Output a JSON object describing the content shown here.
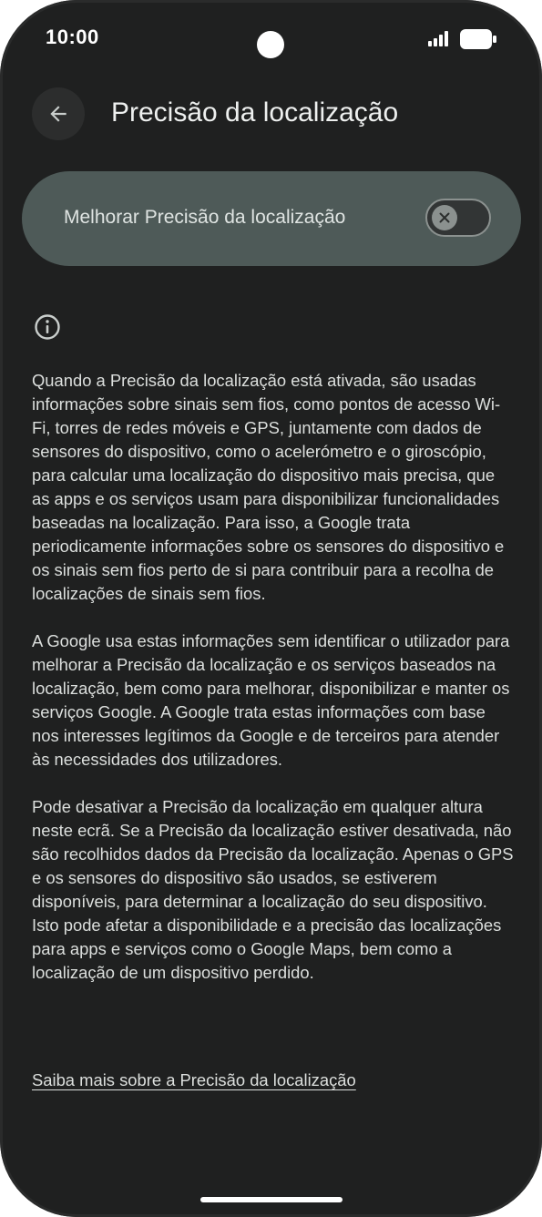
{
  "status_bar": {
    "time": "10:00",
    "icons": [
      "signal-icon",
      "battery-icon"
    ]
  },
  "top_bar": {
    "back_icon": "arrow-left-icon",
    "title": "Precisão da localização"
  },
  "main_toggle": {
    "label": "Melhorar Precisão da localização",
    "state": "off",
    "thumb_icon": "close-icon"
  },
  "info_icon": "info-icon",
  "body": {
    "paragraphs": [
      "Quando a Precisão da localização está ativada, são usadas informações sobre sinais sem fios, como pontos de acesso Wi-Fi, torres de redes móveis e GPS, juntamente com dados de sensores do dispositivo, como o acelerómetro e o giroscópio, para calcular uma localização do dispositivo mais precisa, que as apps e os serviços usam para disponibilizar funcionalidades baseadas na localização. Para isso, a Google trata periodicamente informações sobre os sensores do dispositivo e os sinais sem fios perto de si para contribuir para a recolha de localizações de sinais sem fios.",
      "A Google usa estas informações sem identificar o utilizador para melhorar a Precisão da localização e os serviços baseados na localização, bem como para melhorar, disponibilizar e manter os serviços Google. A Google trata estas informações com base nos interesses legítimos da Google e de terceiros para atender às necessidades dos utilizadores.",
      "Pode desativar a Precisão da localização em qualquer altura neste ecrã. Se a Precisão da localização estiver desativada, não são recolhidos dados da Precisão da localização. Apenas o GPS e os sensores do dispositivo são usados, se estiverem disponíveis, para determinar a localização do seu dispositivo. Isto pode afetar a disponibilidade e a precisão das localizações para apps e serviços como o Google Maps, bem como a localização de um dispositivo perdido."
    ],
    "learn_more_link": "Saiba mais sobre a Precisão da localização"
  },
  "colors": {
    "background": "#1f2020",
    "card": "#4e5a58",
    "text": "#dcdfdd"
  }
}
